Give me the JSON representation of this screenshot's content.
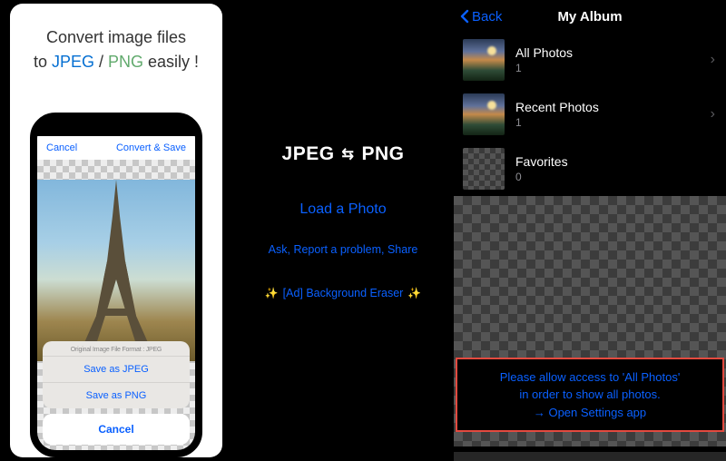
{
  "promo": {
    "headline_pre": "Convert image files",
    "headline_to": "to ",
    "headline_jpeg": "JPEG",
    "headline_slash": " / ",
    "headline_png": "PNG",
    "headline_post": " easily !",
    "nav_cancel": "Cancel",
    "nav_action": "Convert & Save",
    "sheet_label": "Original Image File Format : JPEG",
    "sheet_save_jpeg": "Save as JPEG",
    "sheet_save_png": "Save as PNG",
    "sheet_cancel": "Cancel"
  },
  "home": {
    "title_left": "JPEG",
    "title_right": "PNG",
    "load": "Load a Photo",
    "ask": "Ask, Report a problem, Share",
    "ad": "[Ad] Background Eraser"
  },
  "album": {
    "back": "Back",
    "title": "My Album",
    "rows": [
      {
        "title": "All Photos",
        "count": "1"
      },
      {
        "title": "Recent Photos",
        "count": "1"
      },
      {
        "title": "Favorites",
        "count": "0"
      }
    ],
    "permission_line1": "Please allow access to 'All Photos'",
    "permission_line2": "in order to show all photos.",
    "permission_line3": "→ Open Settings app"
  }
}
